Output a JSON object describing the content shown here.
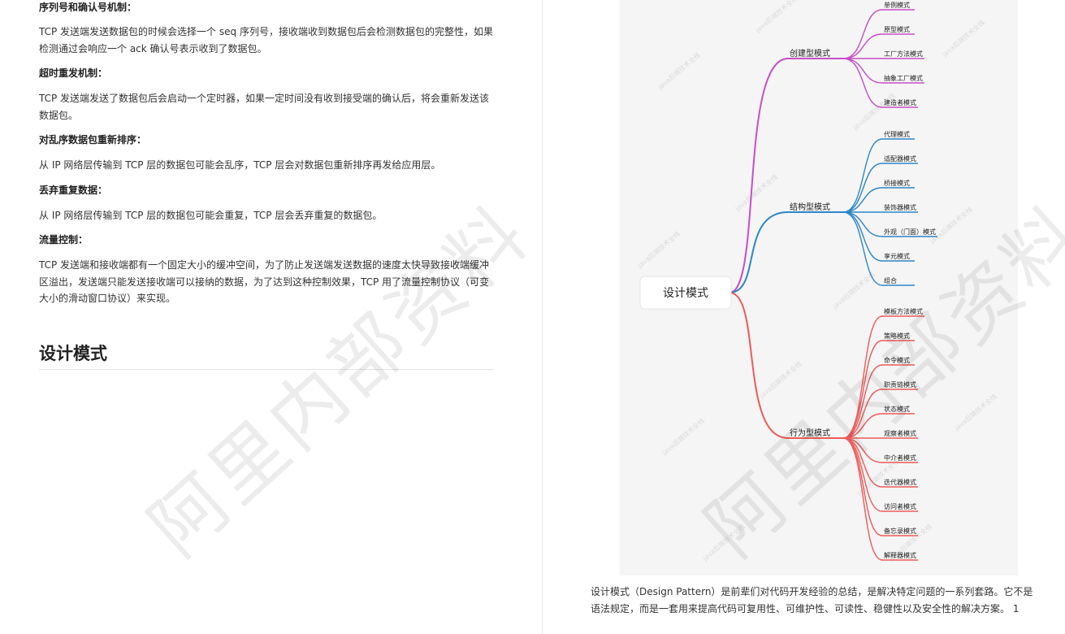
{
  "left": {
    "sections": [
      {
        "heading": "序列号和确认号机制：",
        "text": "TCP 发送端发送数据包的时候会选择一个 seq 序列号，接收端收到数据包后会检测数据包的完整性，如果检测通过会响应一个 ack 确认号表示收到了数据包。"
      },
      {
        "heading": "超时重发机制：",
        "text": "TCP 发送端发送了数据包后会启动一个定时器，如果一定时间没有收到接受端的确认后，将会重新发送该数据包。"
      },
      {
        "heading": "对乱序数据包重新排序：",
        "text": "从 IP 网络层传输到 TCP 层的数据包可能会乱序，TCP 层会对数据包重新排序再发给应用层。"
      },
      {
        "heading": "丢弃重复数据：",
        "text": "从 IP 网络层传输到 TCP 层的数据包可能会重复，TCP 层会丢弃重复的数据包。"
      },
      {
        "heading": "流量控制：",
        "text": "TCP 发送端和接收端都有一个固定大小的缓冲空间，为了防止发送端发送数据的速度太快导致接收端缓冲区溢出，发送端只能发送接收端可以接纳的数据，为了达到这种控制效果，TCP 用了流量控制协议（可变大小的滑动窗口协议）来实现。"
      }
    ],
    "title": "设计模式"
  },
  "watermark": "阿里内部资料",
  "mindmap": {
    "root": "设计模式",
    "small_watermark": "java后端技术全栈",
    "branches": [
      {
        "label": "创建型模式",
        "color": "#c64fc8",
        "leaves": [
          "单例模式",
          "原型模式",
          "工厂方法模式",
          "抽象工厂模式",
          "建造者模式"
        ]
      },
      {
        "label": "结构型模式",
        "color": "#2f86c9",
        "leaves": [
          "代理模式",
          "适配器模式",
          "桥接模式",
          "装饰器模式",
          "外观（门面）模式",
          "享元模式",
          "组合"
        ]
      },
      {
        "label": "行为型模式",
        "color": "#ee5a5a",
        "leaves": [
          "模板方法模式",
          "策略模式",
          "命令模式",
          "职责链模式",
          "状态模式",
          "观察者模式",
          "中介者模式",
          "迭代器模式",
          "访问者模式",
          "备忘录模式",
          "解释器模式"
        ]
      }
    ]
  },
  "caption": "设计模式（Design Pattern）是前辈们对代码开发经验的总结，是解决特定问题的一系列套路。它不是语法规定，而是一套用来提高代码可复用性、可维护性、可读性、稳健性以及安全性的解决方案。 1"
}
